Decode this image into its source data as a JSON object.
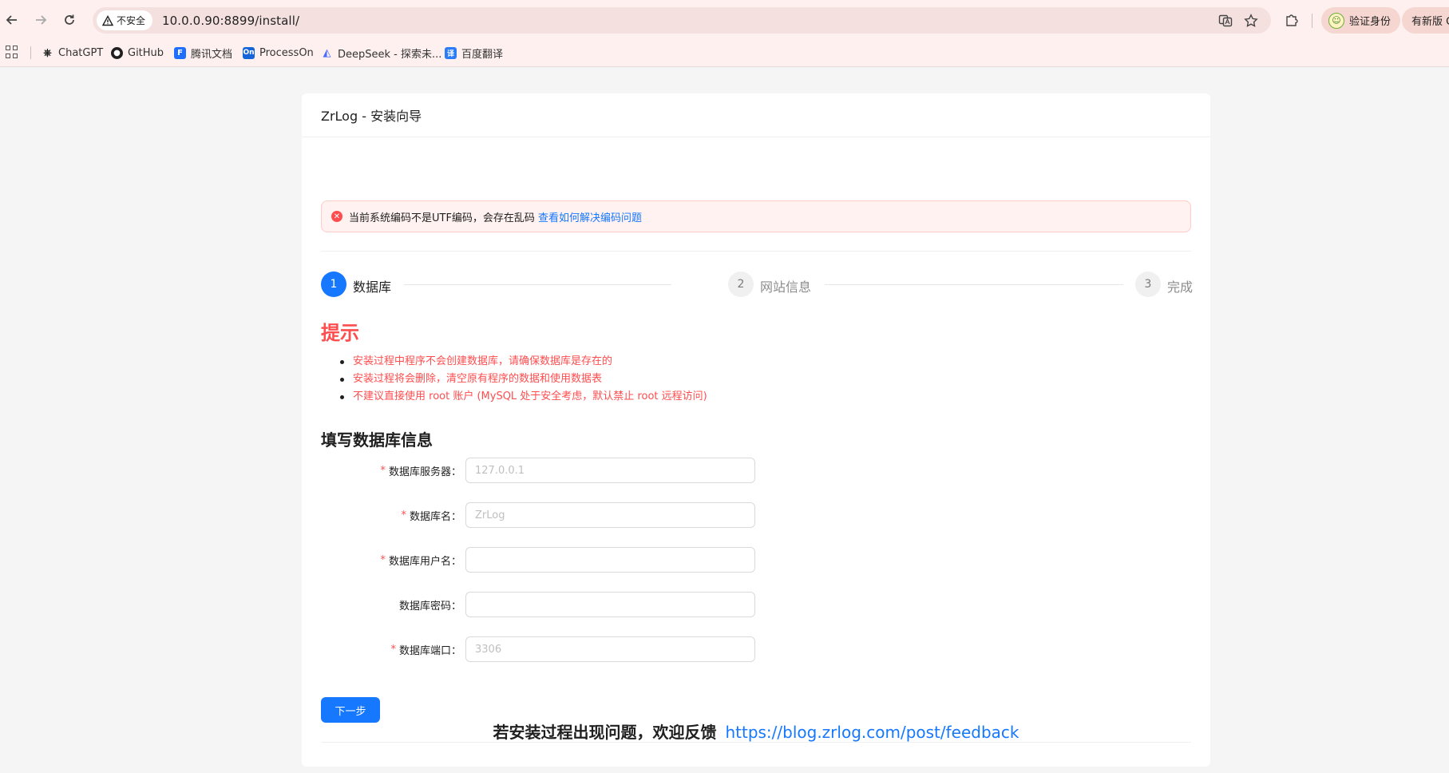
{
  "browser": {
    "security_label": "不安全",
    "url": "10.0.0.90:8899/install/",
    "profile_label": "验证身份",
    "update_label": "有新版 C",
    "bookmarks": [
      {
        "label": "ChatGPT",
        "icon": "chatgpt-icon"
      },
      {
        "label": "GitHub",
        "icon": "github-icon"
      },
      {
        "label": "腾讯文档",
        "icon": "tencent-docs-icon"
      },
      {
        "label": "ProcessOn",
        "icon": "processon-icon"
      },
      {
        "label": "DeepSeek - 探索未...",
        "icon": "deepseek-icon"
      },
      {
        "label": "百度翻译",
        "icon": "baidu-translate-icon"
      }
    ]
  },
  "page": {
    "header_title": "ZrLog - 安装向导",
    "alert": {
      "message": "当前系统编码不是UTF编码，会存在乱码",
      "link_text": "查看如何解决编码问题"
    },
    "steps": [
      {
        "number": "1",
        "title": "数据库",
        "status": "active"
      },
      {
        "number": "2",
        "title": "网站信息",
        "status": "wait"
      },
      {
        "number": "3",
        "title": "完成",
        "status": "wait"
      }
    ],
    "tips": {
      "title": "提示",
      "items": [
        "安装过程中程序不会创建数据库，请确保数据库是存在的",
        "安装过程将会删除，清空原有程序的数据和使用数据表",
        "不建议直接使用 root 账户 (MySQL 处于安全考虑，默认禁止 root 远程访问)"
      ]
    },
    "form": {
      "title": "填写数据库信息",
      "fields": [
        {
          "label": "数据库服务器",
          "required": "*",
          "placeholder": "127.0.0.1",
          "value": ""
        },
        {
          "label": "数据库名",
          "required": "*",
          "placeholder": "ZrLog",
          "value": ""
        },
        {
          "label": "数据库用户名",
          "required": "*",
          "placeholder": "",
          "value": ""
        },
        {
          "label": "数据库密码",
          "required": "",
          "placeholder": "",
          "value": ""
        },
        {
          "label": "数据库端口",
          "required": "*",
          "placeholder": "3306",
          "value": ""
        }
      ],
      "label_suffix": "："
    },
    "next_button": "下一步",
    "feedback": {
      "text": "若安装过程出现问题，欢迎反馈",
      "link": "https://blog.zrlog.com/post/feedback"
    }
  },
  "colors": {
    "primary": "#1677ff",
    "error": "#ff4d4f",
    "chrome_bg": "#fdf0ef"
  }
}
